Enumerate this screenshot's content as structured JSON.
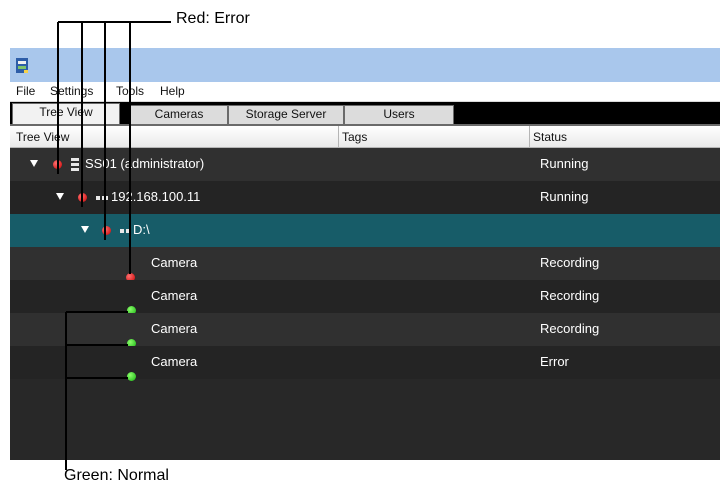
{
  "annotations": {
    "red_label": "Red: Error",
    "green_label": "Green: Normal"
  },
  "menu": [
    "File",
    "Settings",
    "Tools",
    "Help"
  ],
  "tabs": [
    {
      "label": "Tree View",
      "active": true
    },
    {
      "label": "Cameras",
      "active": false
    },
    {
      "label": "Storage Server",
      "active": false
    },
    {
      "label": "Users",
      "active": false
    }
  ],
  "columns": {
    "tree_view": "Tree View",
    "tags": "Tags",
    "status": "Status"
  },
  "rows": [
    {
      "label": "SS01 (administrator)",
      "status": "Running",
      "dot": "red",
      "type": "server"
    },
    {
      "label": "192.168.100.11",
      "status": "Running",
      "dot": "red",
      "type": "host"
    },
    {
      "label": "D:\\",
      "status": "",
      "dot": "red",
      "type": "drive"
    },
    {
      "label": "Camera",
      "status": "Recording",
      "dot": "red",
      "type": "camera"
    },
    {
      "label": "Camera",
      "status": "Recording",
      "dot": "green",
      "type": "camera"
    },
    {
      "label": "Camera",
      "status": "Recording",
      "dot": "green",
      "type": "camera"
    },
    {
      "label": "Camera",
      "status": "Error",
      "dot": "green",
      "type": "camera"
    }
  ],
  "colors": {
    "error_dot": "#d40000",
    "normal_dot": "#22c21a",
    "selected_row": "#175c68",
    "row_dark": "#242424",
    "row_alt": "#303030",
    "titlebar": "#a9c7ec"
  }
}
